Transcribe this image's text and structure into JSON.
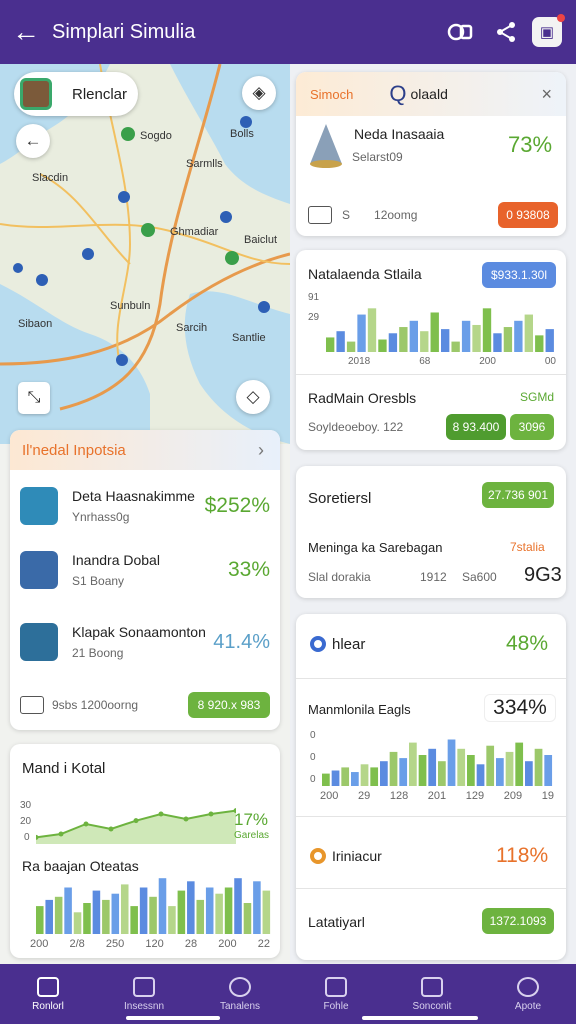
{
  "header": {
    "title": "Simplari Simulia"
  },
  "map": {
    "chip_label": "Rlenclar",
    "labels": [
      "Sogdo",
      "Bolls",
      "Sarmlls",
      "Slacdin",
      "Ghmadiar",
      "Baiclut",
      "Sunbuln",
      "Sibaon",
      "Sarcih",
      "Santlie"
    ]
  },
  "insights": {
    "title": "Il'nedal Inpotsia",
    "items": [
      {
        "name": "Deta Haasnakimme",
        "sub": "Ynrhass0g",
        "value": "$252%"
      },
      {
        "name": "Inandra Dobal",
        "sub": "S1 Boany",
        "value": "33%"
      },
      {
        "name": "Klapak Sonaamonton",
        "sub": "21 Boong",
        "value": "41.4%"
      }
    ],
    "footer_text": "9sbs 1200oorng",
    "footer_pill": "8 920.x 983"
  },
  "trend": {
    "title": "Mand i Kotal",
    "y_ticks": [
      "30",
      "20",
      "0"
    ],
    "badge_value": "17%",
    "badge_caption": "Garelas",
    "sub_title": "Ra baajan Oteatas",
    "x_ticks": [
      "200",
      "2/8",
      "250",
      "120",
      "28",
      "200",
      "22"
    ]
  },
  "summary": {
    "tab1": "Simoch",
    "tab2": "olaald",
    "item_name": "Neda Inasaaia",
    "item_sub": "Selarst09",
    "value": "73%",
    "foot_left": "S",
    "foot_mid": "12oomg",
    "foot_pill": "0 93808"
  },
  "stats": {
    "title": "Natalaenda Stlaila",
    "pill": "$933.1.30l",
    "y_ticks": [
      "91",
      "29"
    ],
    "x_ticks": [
      "2018",
      "68",
      "200",
      "00"
    ],
    "sub_title": "RadMain Oresbls",
    "sub_value": "SGMd",
    "sub_caption": "Soyldeoeboy. 122",
    "pill_a": "8 93.400",
    "pill_b": "3096"
  },
  "sorted": {
    "title": "Soretiersl",
    "pill": "27.736 901",
    "row_label": "Meninga ka Sarebagan",
    "row_value": "7stalia",
    "foot_left": "Slal dorakia",
    "foot_mid": "1912",
    "foot_right": "Sa600",
    "foot_big": "9G3"
  },
  "metric_card": {
    "label": "hlear",
    "value": "48%",
    "row_label": "Manmlonila Eagls",
    "row_value": "334%",
    "y_ticks": [
      "0",
      "0",
      "0"
    ],
    "x_ticks": [
      "200",
      "29",
      "128",
      "201",
      "129",
      "209",
      "19"
    ],
    "indicator_label": "Iriniacur",
    "indicator_value": "118%",
    "bottom_label": "Latatiyarl",
    "bottom_pill": "1372.1093"
  },
  "nav": {
    "items": [
      "Ronlorl",
      "Insessnn",
      "Tanalens",
      "Fohle",
      "Sonconit",
      "Apote"
    ]
  },
  "colors": {
    "brand": "#4a2f8f",
    "accent_green": "#6db33f",
    "accent_orange": "#e8722b",
    "accent_blue": "#5b8be0"
  },
  "chart_data": [
    {
      "type": "line",
      "series": [
        {
          "values": [
            4,
            6,
            12,
            9,
            14,
            18,
            15,
            18,
            20
          ]
        }
      ],
      "ylim": [
        0,
        30
      ]
    },
    {
      "type": "bar",
      "values": [
        18,
        22,
        24,
        30,
        14,
        20,
        28,
        22,
        26,
        32,
        18,
        30,
        24,
        36,
        18,
        28,
        34,
        22,
        30,
        26,
        30,
        36,
        20,
        34,
        28
      ],
      "ylim": [
        0,
        40
      ]
    },
    {
      "type": "bar",
      "values": [
        14,
        20,
        10,
        36,
        42,
        12,
        18,
        24,
        30,
        20,
        38,
        22,
        10,
        30,
        26,
        42,
        18,
        24,
        30,
        36,
        16,
        22
      ],
      "ylim": [
        0,
        50
      ]
    },
    {
      "type": "bar",
      "values": [
        8,
        10,
        12,
        9,
        14,
        12,
        16,
        22,
        18,
        28,
        20,
        24,
        16,
        30,
        24,
        20,
        14,
        26,
        18,
        22,
        28,
        16,
        24,
        20
      ],
      "ylim": [
        0,
        40
      ]
    }
  ]
}
